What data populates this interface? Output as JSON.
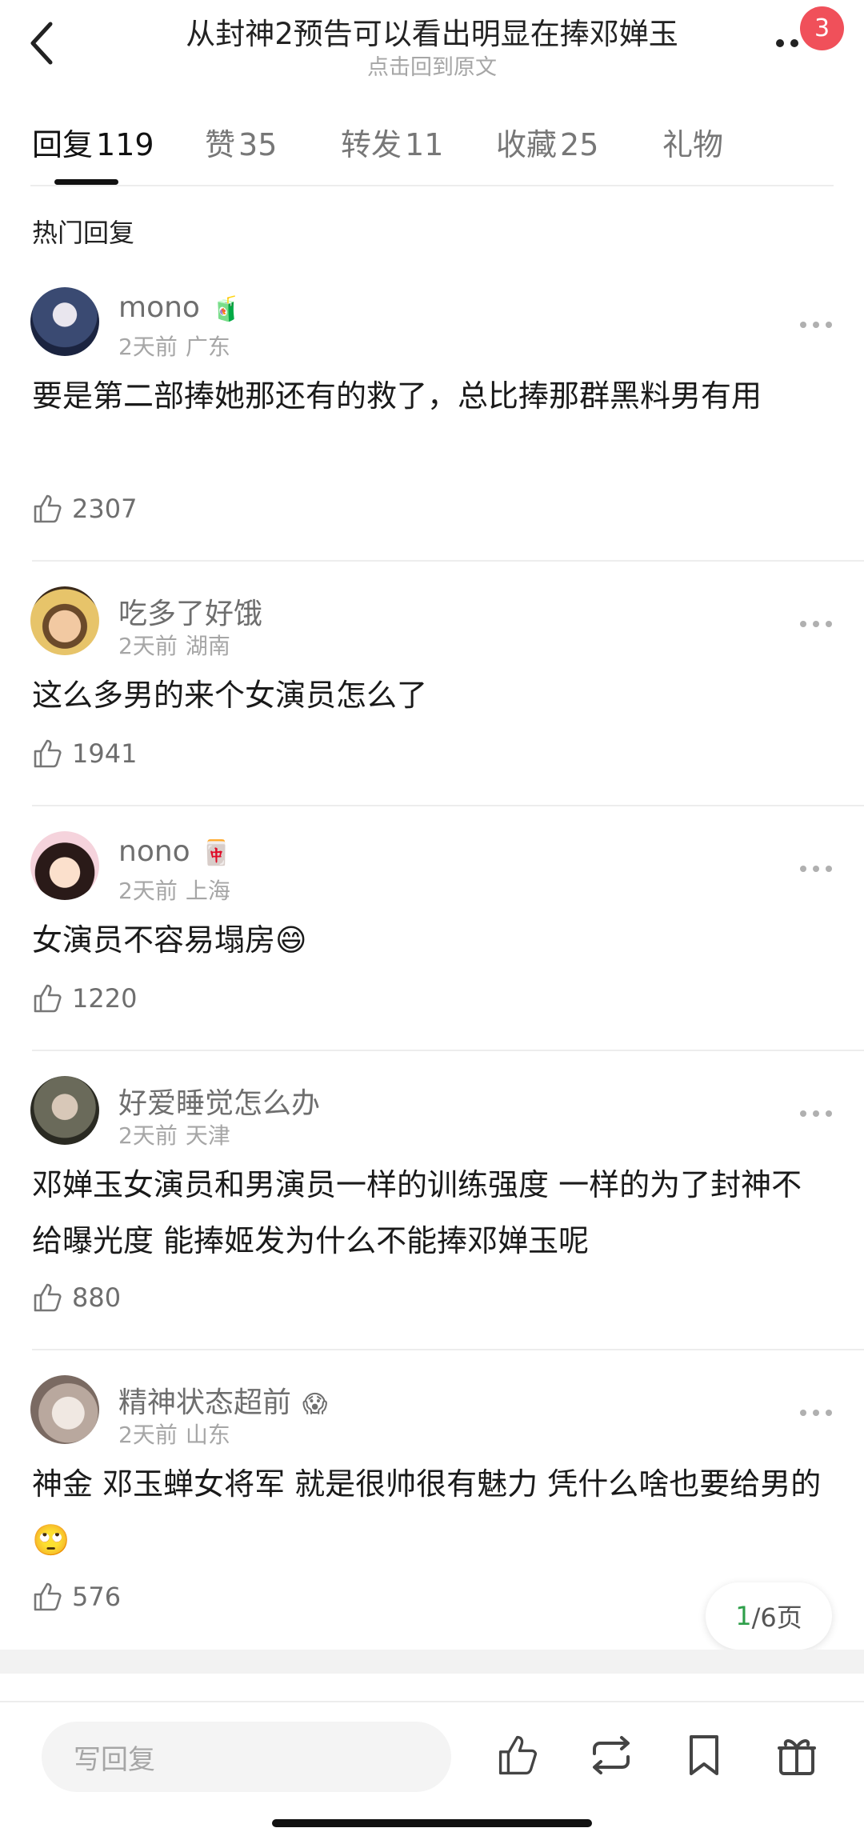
{
  "header": {
    "title": "从封神2预告可以看出明显在捧邓婵玉",
    "subtitle": "点击回到原文",
    "badge_count": "3"
  },
  "tabs": [
    {
      "label": "回复",
      "count": "119"
    },
    {
      "label": "赞",
      "count": "35"
    },
    {
      "label": "转发",
      "count": "11"
    },
    {
      "label": "收藏",
      "count": "25"
    },
    {
      "label": "礼物",
      "count": ""
    }
  ],
  "section_title": "热门回复",
  "comments": [
    {
      "user": "mono",
      "emoji": "🧃",
      "time": "2天前",
      "location": "广东",
      "text": "要是第二部捧她那还有的救了，总比捧那群黑料男有用",
      "likes": "2307"
    },
    {
      "user": "吃多了好饿",
      "emoji": "",
      "time": "2天前",
      "location": "湖南",
      "text": "这么多男的来个女演员怎么了",
      "likes": "1941"
    },
    {
      "user": "nono",
      "emoji": "🀄",
      "time": "2天前",
      "location": "上海",
      "text": "女演员不容易塌房😄",
      "likes": "1220"
    },
    {
      "user": "好爱睡觉怎么办",
      "emoji": "",
      "time": "2天前",
      "location": "天津",
      "text": "邓婵玉女演员和男演员一样的训练强度 一样的为了封神不给曝光度 能捧姬发为什么不能捧邓婵玉呢",
      "likes": "880"
    },
    {
      "user": "精神状态超前",
      "emoji": "😱",
      "time": "2天前",
      "location": "山东",
      "text": "神金 邓玉蝉女将军 就是很帅很有魅力 凭什么啥也要给男的🙄",
      "likes": "576"
    }
  ],
  "pager": {
    "current": "1",
    "total_text": "/6页"
  },
  "bottom": {
    "reply_placeholder": "写回复"
  },
  "colors": {
    "badge": "#f0505a",
    "pager_current": "#2e9f4a"
  },
  "icons": [
    "back-arrow-icon",
    "more-dots-icon",
    "thumbs-up-icon",
    "repost-icon",
    "bookmark-icon",
    "gift-icon"
  ]
}
